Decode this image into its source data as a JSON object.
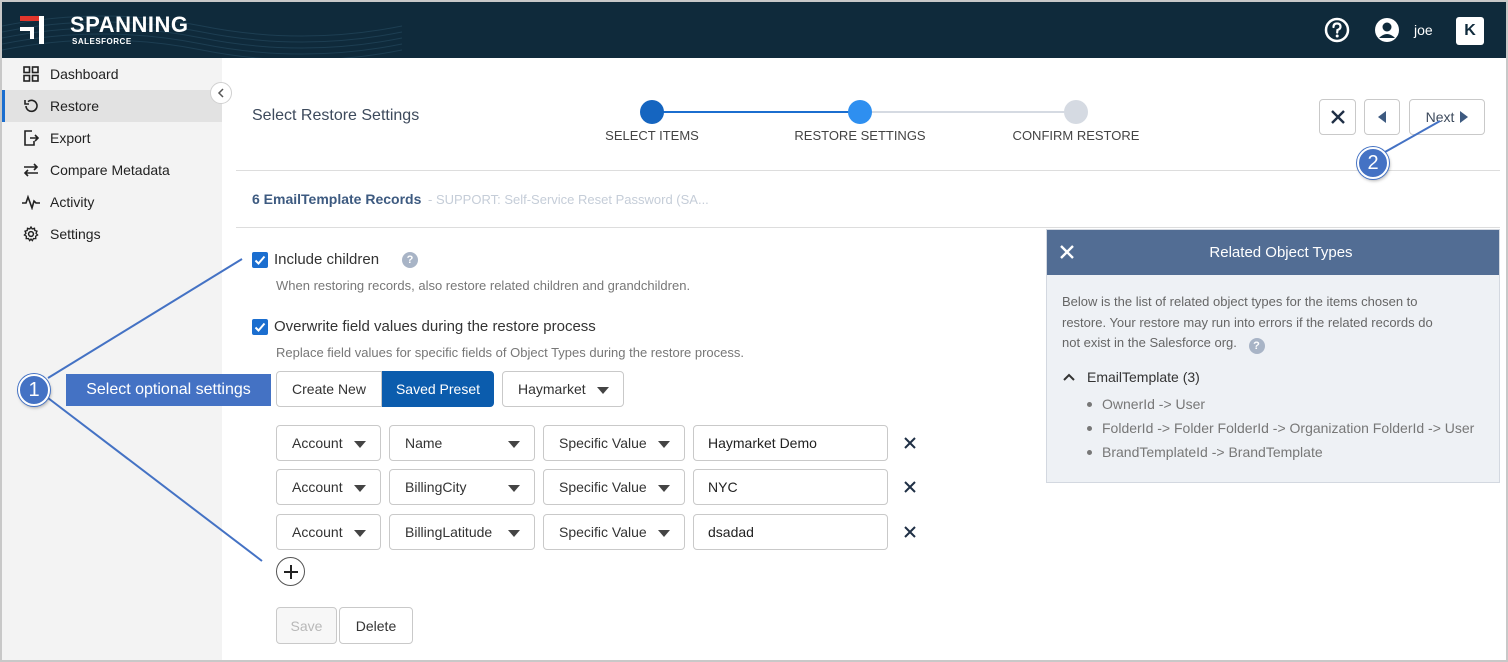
{
  "app": {
    "brand": "SPANNING",
    "brand_sub": "SALESFORCE",
    "user": "joe"
  },
  "colors": {
    "header_bg": "#0f2a3b",
    "accent": "#1b6ecf",
    "panel_header": "#526d94",
    "annotation": "#4472c4"
  },
  "sidebar": {
    "items": [
      {
        "label": "Dashboard",
        "icon": "dashboard-grid-icon"
      },
      {
        "label": "Restore",
        "icon": "restore-icon",
        "active": true
      },
      {
        "label": "Export",
        "icon": "export-icon"
      },
      {
        "label": "Compare Metadata",
        "icon": "compare-arrows-icon"
      },
      {
        "label": "Activity",
        "icon": "activity-pulse-icon"
      },
      {
        "label": "Settings",
        "icon": "gear-icon"
      }
    ]
  },
  "main": {
    "title": "Select Restore Settings",
    "steps": [
      {
        "label": "SELECT ITEMS",
        "state": "done"
      },
      {
        "label": "RESTORE SETTINGS",
        "state": "current"
      },
      {
        "label": "CONFIRM RESTORE",
        "state": "pending"
      }
    ],
    "next_label": "Next",
    "records_title": "6 EmailTemplate Records",
    "records_subtitle": "- SUPPORT: Self-Service Reset Password (SA...",
    "options": [
      {
        "title": "Include children",
        "desc": "When restoring records, also restore related children and grandchildren.",
        "checked": true
      },
      {
        "title": "Overwrite field values during the restore process",
        "desc": "Replace field values for specific fields of Object Types during the restore process.",
        "checked": true
      }
    ],
    "preset_tabs": {
      "create_new": "Create New",
      "saved_preset": "Saved Preset"
    },
    "preset_selected": "Haymarket",
    "rules": [
      {
        "object": "Account",
        "field": "Name",
        "mode": "Specific Value",
        "value": "Haymarket Demo"
      },
      {
        "object": "Account",
        "field": "BillingCity",
        "mode": "Specific Value",
        "value": "NYC"
      },
      {
        "object": "Account",
        "field": "BillingLatitude",
        "mode": "Specific Value",
        "value": "dsadad"
      }
    ],
    "save_label": "Save",
    "delete_label": "Delete"
  },
  "related_panel": {
    "title": "Related Object Types",
    "description": "Below is the list of related object types for the items chosen to restore. Your restore may run into errors if the related records do not exist in the Salesforce org.",
    "group_label": "EmailTemplate (3)",
    "items": [
      "OwnerId -> User",
      "FolderId -> Folder FolderId -> Organization FolderId -> User",
      "BrandTemplateId -> BrandTemplate"
    ]
  },
  "annotations": {
    "callout_1": "1",
    "callout_1_label": "Select optional settings",
    "callout_2": "2"
  }
}
